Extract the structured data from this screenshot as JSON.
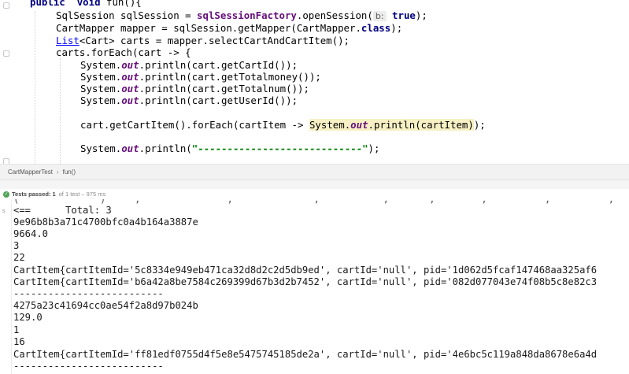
{
  "editor": {
    "lines": {
      "l1_kw1": "public",
      "l1_kw2": "void",
      "l1_rest": " fun(){",
      "l2_a": "SqlSession sqlSession = ",
      "l2_field": "sqlSessionFactory",
      "l2_b": ".openSession(",
      "l2_hint": "b:",
      "l2_val": "true",
      "l2_c": ");",
      "l3_a": "CartMapper mapper = sqlSession.getMapper(CartMapper.",
      "l3_kw": "class",
      "l3_b": ");",
      "l4_type": "List",
      "l4_rest": "<Cart> carts = mapper.selectCartAndCartItem();",
      "l5": "carts.forEach(cart -> {",
      "l6_a": "System.",
      "l6_out": "out",
      "l6_b": ".println(cart.getCartId());",
      "l7_b": ".println(cart.getTotalmoney());",
      "l8_b": ".println(cart.getTotalnum());",
      "l9_b": ".println(cart.getUserId());",
      "l10_a": "cart.getCartItem().forEach(cartItem -> ",
      "l10_hl_a": "System.",
      "l10_hl_b": ".println(cartItem)",
      "l10_c": ");",
      "l11_a": "System.",
      "l11_b": ".println(",
      "l11_str": "\"----------------------------\"",
      "l11_c": ");"
    }
  },
  "breadcrumb": {
    "class_name": "CartMapperTest",
    "separator": "›",
    "method": "fun()"
  },
  "run": {
    "status_label": "Tests passed:",
    "status_count": "1",
    "status_detail": "of 1 test – 975 ms",
    "gutter_label": "s",
    "console_lines": [
      "(              )     ,               ,              ,           ,       ,        ,          ,          ,           ,",
      "<==      Total: 3",
      "9e96b8b3a71c4700bfc0a4b164a3887e",
      "9664.0",
      "3",
      "22",
      "CartItem{cartItemId='5c8334e949eb471ca32d8d2c2d5db9ed', cartId='null', pid='1d062d5fcaf147468aa325af6",
      "CartItem{cartItemId='b6a42a8be7584c269399d67b3d2b7452', cartId='null', pid='082d077043e74f08b5c8e82c3",
      "--------------------------",
      "4275a23c41694cc0ae54f2a8d97b024b",
      "129.0",
      "1",
      "16",
      "CartItem{cartItemId='ff81edf0755d4f5e8e5475745185de2a', cartId='null', pid='4e6bc5c119a848da8678e6a4d",
      "--------------------------"
    ]
  }
}
